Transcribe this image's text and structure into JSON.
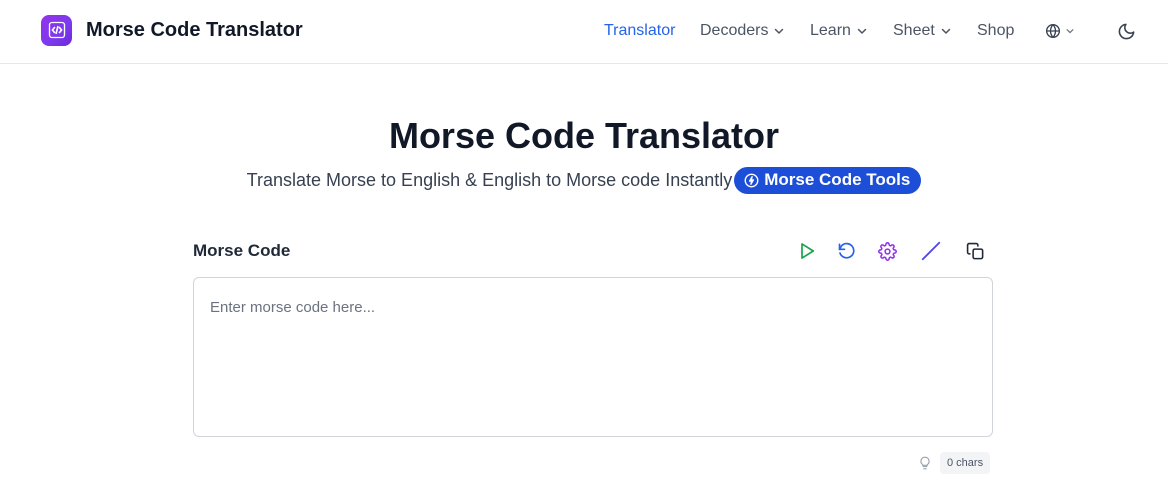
{
  "header": {
    "brand_title": "Morse Code Translator",
    "nav": {
      "translator": "Translator",
      "decoders": "Decoders",
      "learn": "Learn",
      "sheet": "Sheet",
      "shop": "Shop"
    }
  },
  "hero": {
    "title": "Morse Code Translator",
    "subtitle": "Translate Morse to English & English to Morse code Instantly",
    "tools_button": "Morse Code Tools"
  },
  "editor": {
    "label": "Morse Code",
    "placeholder": "Enter morse code here...",
    "value": "",
    "char_count": "0 chars"
  },
  "icons": {
    "brand": "code-icon",
    "language": "globe-icon",
    "theme": "moon-icon",
    "tools_button": "bolt-icon",
    "play": "play-icon",
    "reset": "rotate-ccw-icon",
    "settings": "gear-icon",
    "slash": "slash-icon",
    "copy": "copy-icon",
    "hint": "lightbulb-icon"
  },
  "colors": {
    "accent": "#2563eb",
    "brand_gradient_start": "#9333ea",
    "pill": "#1d4ed8",
    "play": "#16a34a",
    "reset": "#2563eb",
    "settings": "#9333ea",
    "slash": "#4f46e5",
    "text": "#111827"
  }
}
